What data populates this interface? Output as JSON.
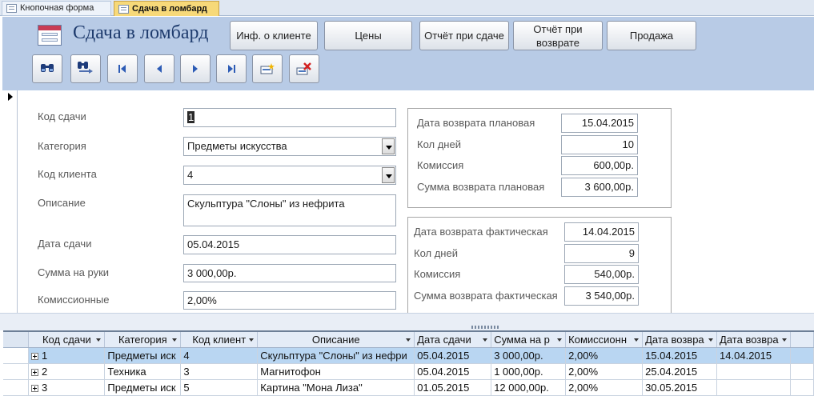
{
  "tabs": [
    {
      "label": "Кнопочная форма",
      "icon": "form-icon",
      "active": false
    },
    {
      "label": "Сдача в ломбард",
      "icon": "form-icon",
      "active": true
    }
  ],
  "header": {
    "title": "Сдача в ломбард",
    "buttons": [
      "Инф. о клиенте",
      "Цены",
      "Отчёт при сдаче",
      "Отчёт при возврате",
      "Продажа"
    ],
    "nav_icons": [
      "find-icon",
      "find-next-icon",
      "first-record-icon",
      "previous-record-icon",
      "next-record-icon",
      "last-record-icon",
      "new-record-icon",
      "delete-record-icon"
    ]
  },
  "form": {
    "code_label": "Код сдачи",
    "code_value": "1",
    "category_label": "Категория",
    "category_value": "Предметы искусства",
    "client_label": "Код клиента",
    "client_value": "4",
    "description_label": "Описание",
    "description_value": "Скульптура \"Слоны\" из нефрита",
    "date_label": "Дата сдачи",
    "date_value": "05.04.2015",
    "amount_label": "Сумма на руки",
    "amount_value": "3 000,00р.",
    "commission_label": "Комиссионные",
    "commission_value": "2,00%"
  },
  "planned": {
    "date_label": "Дата возврата плановая",
    "date_value": "15.04.2015",
    "days_label": "Кол дней",
    "days_value": "10",
    "commission_label": "Комиссия",
    "commission_value": "600,00р.",
    "sum_label": "Сумма возврата плановая",
    "sum_value": "3 600,00р."
  },
  "actual": {
    "date_label": "Дата возврата фактическая",
    "date_value": "14.04.2015",
    "days_label": "Кол дней",
    "days_value": "9",
    "commission_label": "Комиссия",
    "commission_value": "540,00р.",
    "sum_label": "Сумма возврата фактическая",
    "sum_value": "3 540,00р."
  },
  "datasheet": {
    "columns": [
      "Код сдачи",
      "Категория",
      "Код клиент",
      "Описание",
      "Дата сдачи",
      "Сумма на р",
      "Комиссионн",
      "Дата возвра",
      "Дата возвра"
    ],
    "rows": [
      [
        "1",
        "Предметы иск",
        "4",
        "Скульптура \"Слоны\" из нефри",
        "05.04.2015",
        "3 000,00р.",
        "2,00%",
        "15.04.2015",
        "14.04.2015"
      ],
      [
        "2",
        "Техника",
        "3",
        "Магнитофон",
        "05.04.2015",
        "1 000,00р.",
        "2,00%",
        "25.04.2015",
        ""
      ],
      [
        "3",
        "Предметы иск",
        "5",
        "Картина \"Мона Лиза\"",
        "01.05.2015",
        "12 000,00р.",
        "2,00%",
        "30.05.2015",
        ""
      ]
    ]
  }
}
